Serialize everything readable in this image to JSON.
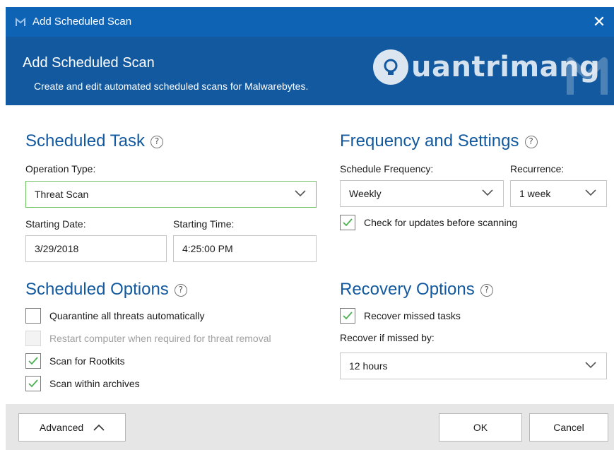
{
  "window": {
    "title": "Add Scheduled Scan",
    "close_glyph": "✕"
  },
  "header": {
    "title": "Add Scheduled Scan",
    "subtitle": "Create and edit automated scheduled scans for Malwarebytes.",
    "watermark": "uantrimang"
  },
  "scheduled_task": {
    "title": "Scheduled Task",
    "operation_type_label": "Operation Type:",
    "operation_type_value": "Threat Scan",
    "starting_date_label": "Starting Date:",
    "starting_date_value": "3/29/2018",
    "starting_time_label": "Starting Time:",
    "starting_time_value": "4:25:00 PM"
  },
  "frequency": {
    "title": "Frequency and Settings",
    "schedule_frequency_label": "Schedule Frequency:",
    "schedule_frequency_value": "Weekly",
    "recurrence_label": "Recurrence:",
    "recurrence_value": "1 week",
    "check_updates_label": "Check for updates before scanning",
    "check_updates_checked": true
  },
  "scheduled_options": {
    "title": "Scheduled Options",
    "items": [
      {
        "label": "Quarantine all threats automatically",
        "checked": false,
        "disabled": false
      },
      {
        "label": "Restart computer when required for threat removal",
        "checked": false,
        "disabled": true
      },
      {
        "label": "Scan for Rootkits",
        "checked": true,
        "disabled": false
      },
      {
        "label": "Scan within archives",
        "checked": true,
        "disabled": false
      }
    ]
  },
  "recovery": {
    "title": "Recovery Options",
    "recover_missed_label": "Recover missed tasks",
    "recover_missed_checked": true,
    "recover_if_missed_label": "Recover if missed by:",
    "recover_if_missed_value": "12 hours"
  },
  "footer": {
    "advanced_label": "Advanced",
    "ok_label": "OK",
    "cancel_label": "Cancel"
  },
  "colors": {
    "accent": "#12599f",
    "titlebar": "#0f63b5",
    "check_green": "#4caf50",
    "active_border": "#6bbf5e"
  },
  "icons": [
    "malwarebytes-app-icon",
    "close-icon",
    "help-icon",
    "chevron-down-icon",
    "checkmark-icon",
    "chevron-up-icon"
  ]
}
